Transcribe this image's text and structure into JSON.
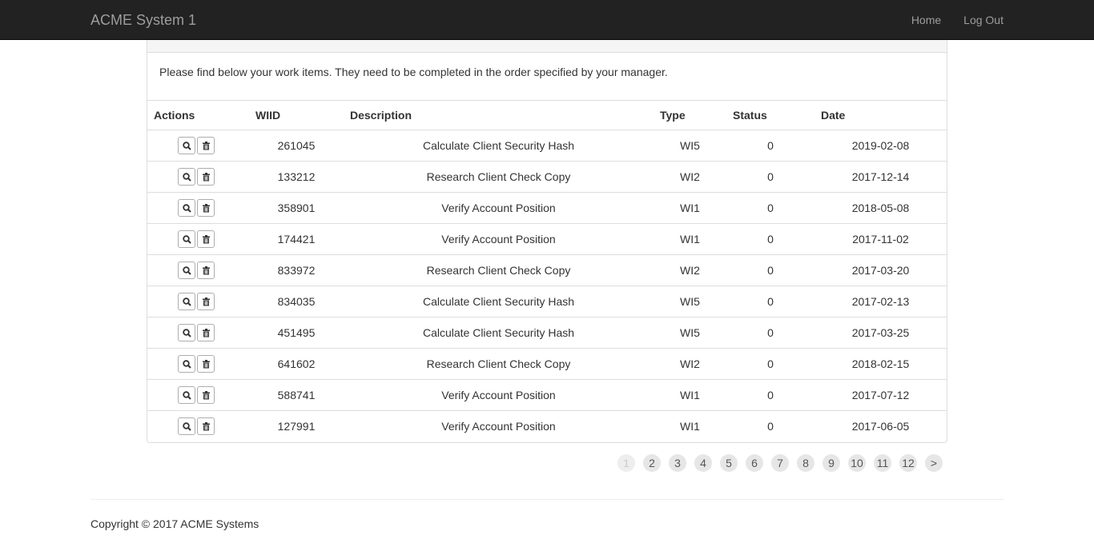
{
  "navbar": {
    "brand": "ACME System 1",
    "links": [
      {
        "label": "Home"
      },
      {
        "label": "Log Out"
      }
    ]
  },
  "intro": {
    "text": "Please find below your work items. They need to be completed in the order specified by your manager."
  },
  "table": {
    "headers": [
      "Actions",
      "WIID",
      "Description",
      "Type",
      "Status",
      "Date"
    ],
    "rows": [
      {
        "wiid": "261045",
        "description": "Calculate Client Security Hash",
        "type": "WI5",
        "status": "0",
        "date": "2019-02-08"
      },
      {
        "wiid": "133212",
        "description": "Research Client Check Copy",
        "type": "WI2",
        "status": "0",
        "date": "2017-12-14"
      },
      {
        "wiid": "358901",
        "description": "Verify Account Position",
        "type": "WI1",
        "status": "0",
        "date": "2018-05-08"
      },
      {
        "wiid": "174421",
        "description": "Verify Account Position",
        "type": "WI1",
        "status": "0",
        "date": "2017-11-02"
      },
      {
        "wiid": "833972",
        "description": "Research Client Check Copy",
        "type": "WI2",
        "status": "0",
        "date": "2017-03-20"
      },
      {
        "wiid": "834035",
        "description": "Calculate Client Security Hash",
        "type": "WI5",
        "status": "0",
        "date": "2017-02-13"
      },
      {
        "wiid": "451495",
        "description": "Calculate Client Security Hash",
        "type": "WI5",
        "status": "0",
        "date": "2017-03-25"
      },
      {
        "wiid": "641602",
        "description": "Research Client Check Copy",
        "type": "WI2",
        "status": "0",
        "date": "2018-02-15"
      },
      {
        "wiid": "588741",
        "description": "Verify Account Position",
        "type": "WI1",
        "status": "0",
        "date": "2017-07-12"
      },
      {
        "wiid": "127991",
        "description": "Verify Account Position",
        "type": "WI1",
        "status": "0",
        "date": "2017-06-05"
      }
    ],
    "row_actions": [
      {
        "icon": "search-icon"
      },
      {
        "icon": "trash-icon"
      }
    ]
  },
  "pagination": {
    "pages": [
      "1",
      "2",
      "3",
      "4",
      "5",
      "6",
      "7",
      "8",
      "9",
      "10",
      "11",
      "12",
      ">"
    ],
    "current": "1"
  },
  "footer": {
    "copyright": "Copyright © 2017 ACME Systems"
  },
  "colors": {
    "navbar_bg": "#222222",
    "navbar_text": "#9d9d9d",
    "border": "#dddddd",
    "page_btn_bg": "#e6e6e6"
  }
}
